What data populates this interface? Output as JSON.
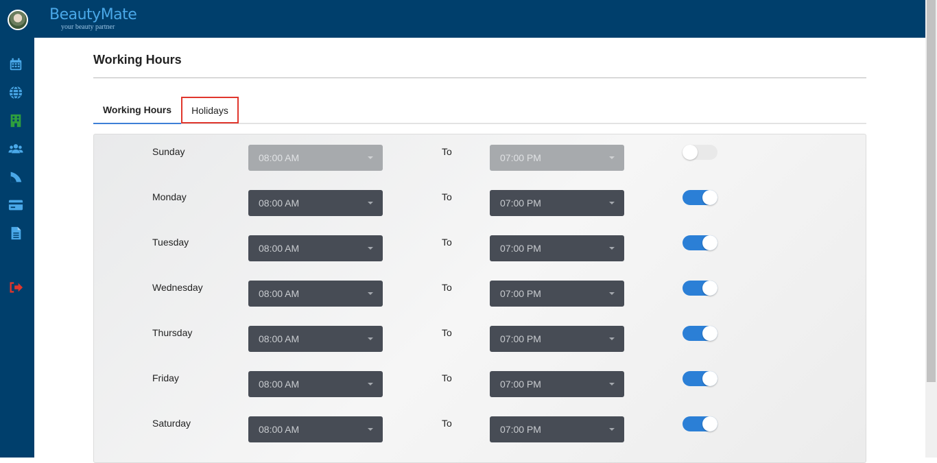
{
  "brand": {
    "name": "BeautyMate",
    "tagline": "your beauty partner"
  },
  "sidebar": {
    "items": [
      {
        "name": "calendar-icon",
        "color": "#4aa8e8"
      },
      {
        "name": "globe-icon",
        "color": "#4aa8e8"
      },
      {
        "name": "building-icon",
        "color": "#2e9e3e"
      },
      {
        "name": "users-icon",
        "color": "#4aa8e8"
      },
      {
        "name": "feed-icon",
        "color": "#4aa8e8"
      },
      {
        "name": "credit-card-icon",
        "color": "#4aa8e8"
      },
      {
        "name": "document-icon",
        "color": "#4aa8e8"
      },
      {
        "name": "logout-icon",
        "color": "#e0362c"
      }
    ]
  },
  "page": {
    "title": "Working Hours"
  },
  "tabs": [
    {
      "label": "Working Hours",
      "active": true
    },
    {
      "label": "Holidays",
      "active": false
    }
  ],
  "schedule": {
    "to_label": "To",
    "days": [
      {
        "day": "Sunday",
        "from": "08:00 AM",
        "to": "07:00 PM",
        "enabled": false
      },
      {
        "day": "Monday",
        "from": "08:00 AM",
        "to": "07:00 PM",
        "enabled": true
      },
      {
        "day": "Tuesday",
        "from": "08:00 AM",
        "to": "07:00 PM",
        "enabled": true
      },
      {
        "day": "Wednesday",
        "from": "08:00 AM",
        "to": "07:00 PM",
        "enabled": true
      },
      {
        "day": "Thursday",
        "from": "08:00 AM",
        "to": "07:00 PM",
        "enabled": true
      },
      {
        "day": "Friday",
        "from": "08:00 AM",
        "to": "07:00 PM",
        "enabled": true
      },
      {
        "day": "Saturday",
        "from": "08:00 AM",
        "to": "07:00 PM",
        "enabled": true
      }
    ]
  },
  "colors": {
    "topbar": "#003f6c",
    "accent": "#2b7fd6",
    "highlight": "#e0362c"
  }
}
